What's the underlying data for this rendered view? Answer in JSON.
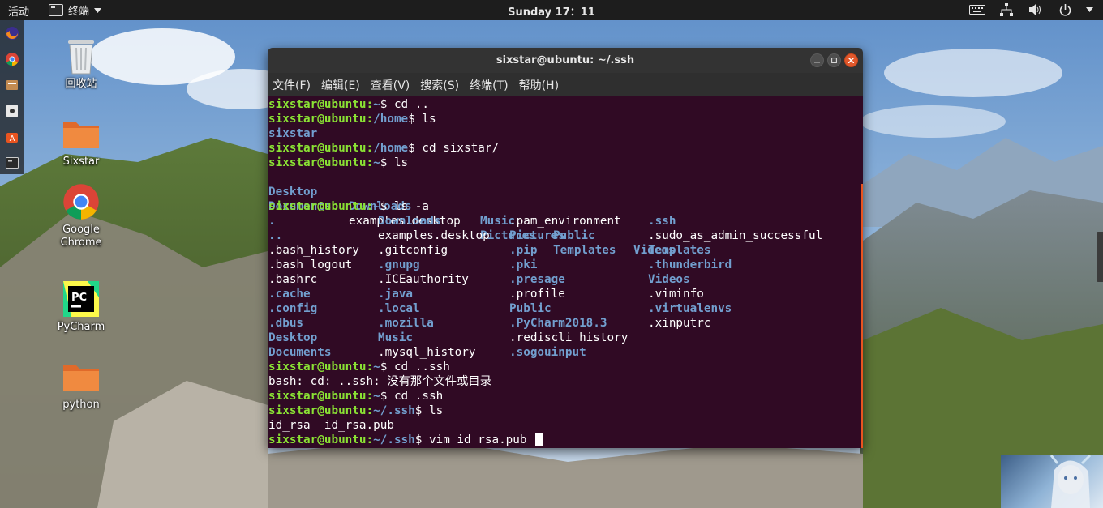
{
  "topbar": {
    "activities": "活动",
    "app_menu": "终端",
    "clock": "Sunday 17：11"
  },
  "dock": {
    "items": [
      "firefox-icon",
      "chrome-icon",
      "files-icon",
      "rhythmbox-icon",
      "software-icon",
      "terminal-icon"
    ]
  },
  "desktop": {
    "icons": [
      {
        "label": "回收站",
        "icon": "trash-icon"
      },
      {
        "label": "Sixstar",
        "icon": "folder-icon"
      },
      {
        "label": "Google Chrome",
        "icon": "chrome-icon"
      },
      {
        "label": "PyCharm",
        "icon": "pycharm-icon"
      },
      {
        "label": "python",
        "icon": "folder-icon"
      }
    ]
  },
  "window": {
    "title": "sixstar@ubuntu: ~/.ssh",
    "menu": [
      "文件(F)",
      "编辑(E)",
      "查看(V)",
      "搜索(S)",
      "终端(T)",
      "帮助(H)"
    ]
  },
  "terminal": {
    "prompt_user": "sixstar@ubuntu",
    "lines": [
      {
        "path": "~",
        "cmd": " cd .."
      },
      {
        "path": "/home",
        "cmd": " ls"
      },
      {
        "text": "sixstar"
      },
      {
        "path": "/home",
        "cmd": " cd sixstar/"
      },
      {
        "path": "~",
        "cmd": " ls"
      },
      {
        "path": "~",
        "cmd": " ls -a"
      },
      {
        "path": "~",
        "cmd": " cd ..ssh"
      },
      {
        "text": "bash: cd: ..ssh: 没有那个文件或目录"
      },
      {
        "path": "~",
        "cmd": " cd .ssh"
      },
      {
        "path": "~/.ssh",
        "cmd": " ls"
      },
      {
        "text": "id_rsa  id_rsa.pub"
      },
      {
        "path": "~/.ssh",
        "cmd": " vim id_rsa.pub "
      }
    ],
    "ls_home": [
      [
        "Desktop",
        "Downloads",
        "Music",
        "Public",
        "Videos"
      ],
      [
        "Documents",
        "examples.desktop",
        "Pictures",
        "Templates"
      ]
    ],
    "ls_a": [
      [
        ".",
        "Downloads",
        ".pam_environment",
        ".ssh"
      ],
      [
        "..",
        "examples.desktop",
        "Pictures",
        ".sudo_as_admin_successful"
      ],
      [
        ".bash_history",
        ".gitconfig",
        ".pip",
        "Templates"
      ],
      [
        ".bash_logout",
        ".gnupg",
        ".pki",
        ".thunderbird"
      ],
      [
        ".bashrc",
        ".ICEauthority",
        ".presage",
        "Videos"
      ],
      [
        ".cache",
        ".java",
        ".profile",
        ".viminfo"
      ],
      [
        ".config",
        ".local",
        "Public",
        ".virtualenvs"
      ],
      [
        ".dbus",
        ".mozilla",
        ".PyCharm2018.3",
        ".xinputrc"
      ],
      [
        "Desktop",
        "Music",
        ".rediscli_history",
        ""
      ],
      [
        "Documents",
        ".mysql_history",
        ".sogouinput",
        ""
      ]
    ],
    "ls_a_dirs": [
      [
        true,
        true,
        false,
        true
      ],
      [
        true,
        false,
        true,
        false
      ],
      [
        false,
        false,
        true,
        true
      ],
      [
        false,
        true,
        true,
        true
      ],
      [
        false,
        false,
        true,
        true
      ],
      [
        true,
        true,
        false,
        false
      ],
      [
        true,
        true,
        true,
        true
      ],
      [
        true,
        true,
        true,
        false
      ],
      [
        true,
        true,
        false,
        false
      ],
      [
        true,
        false,
        true,
        false
      ]
    ]
  }
}
